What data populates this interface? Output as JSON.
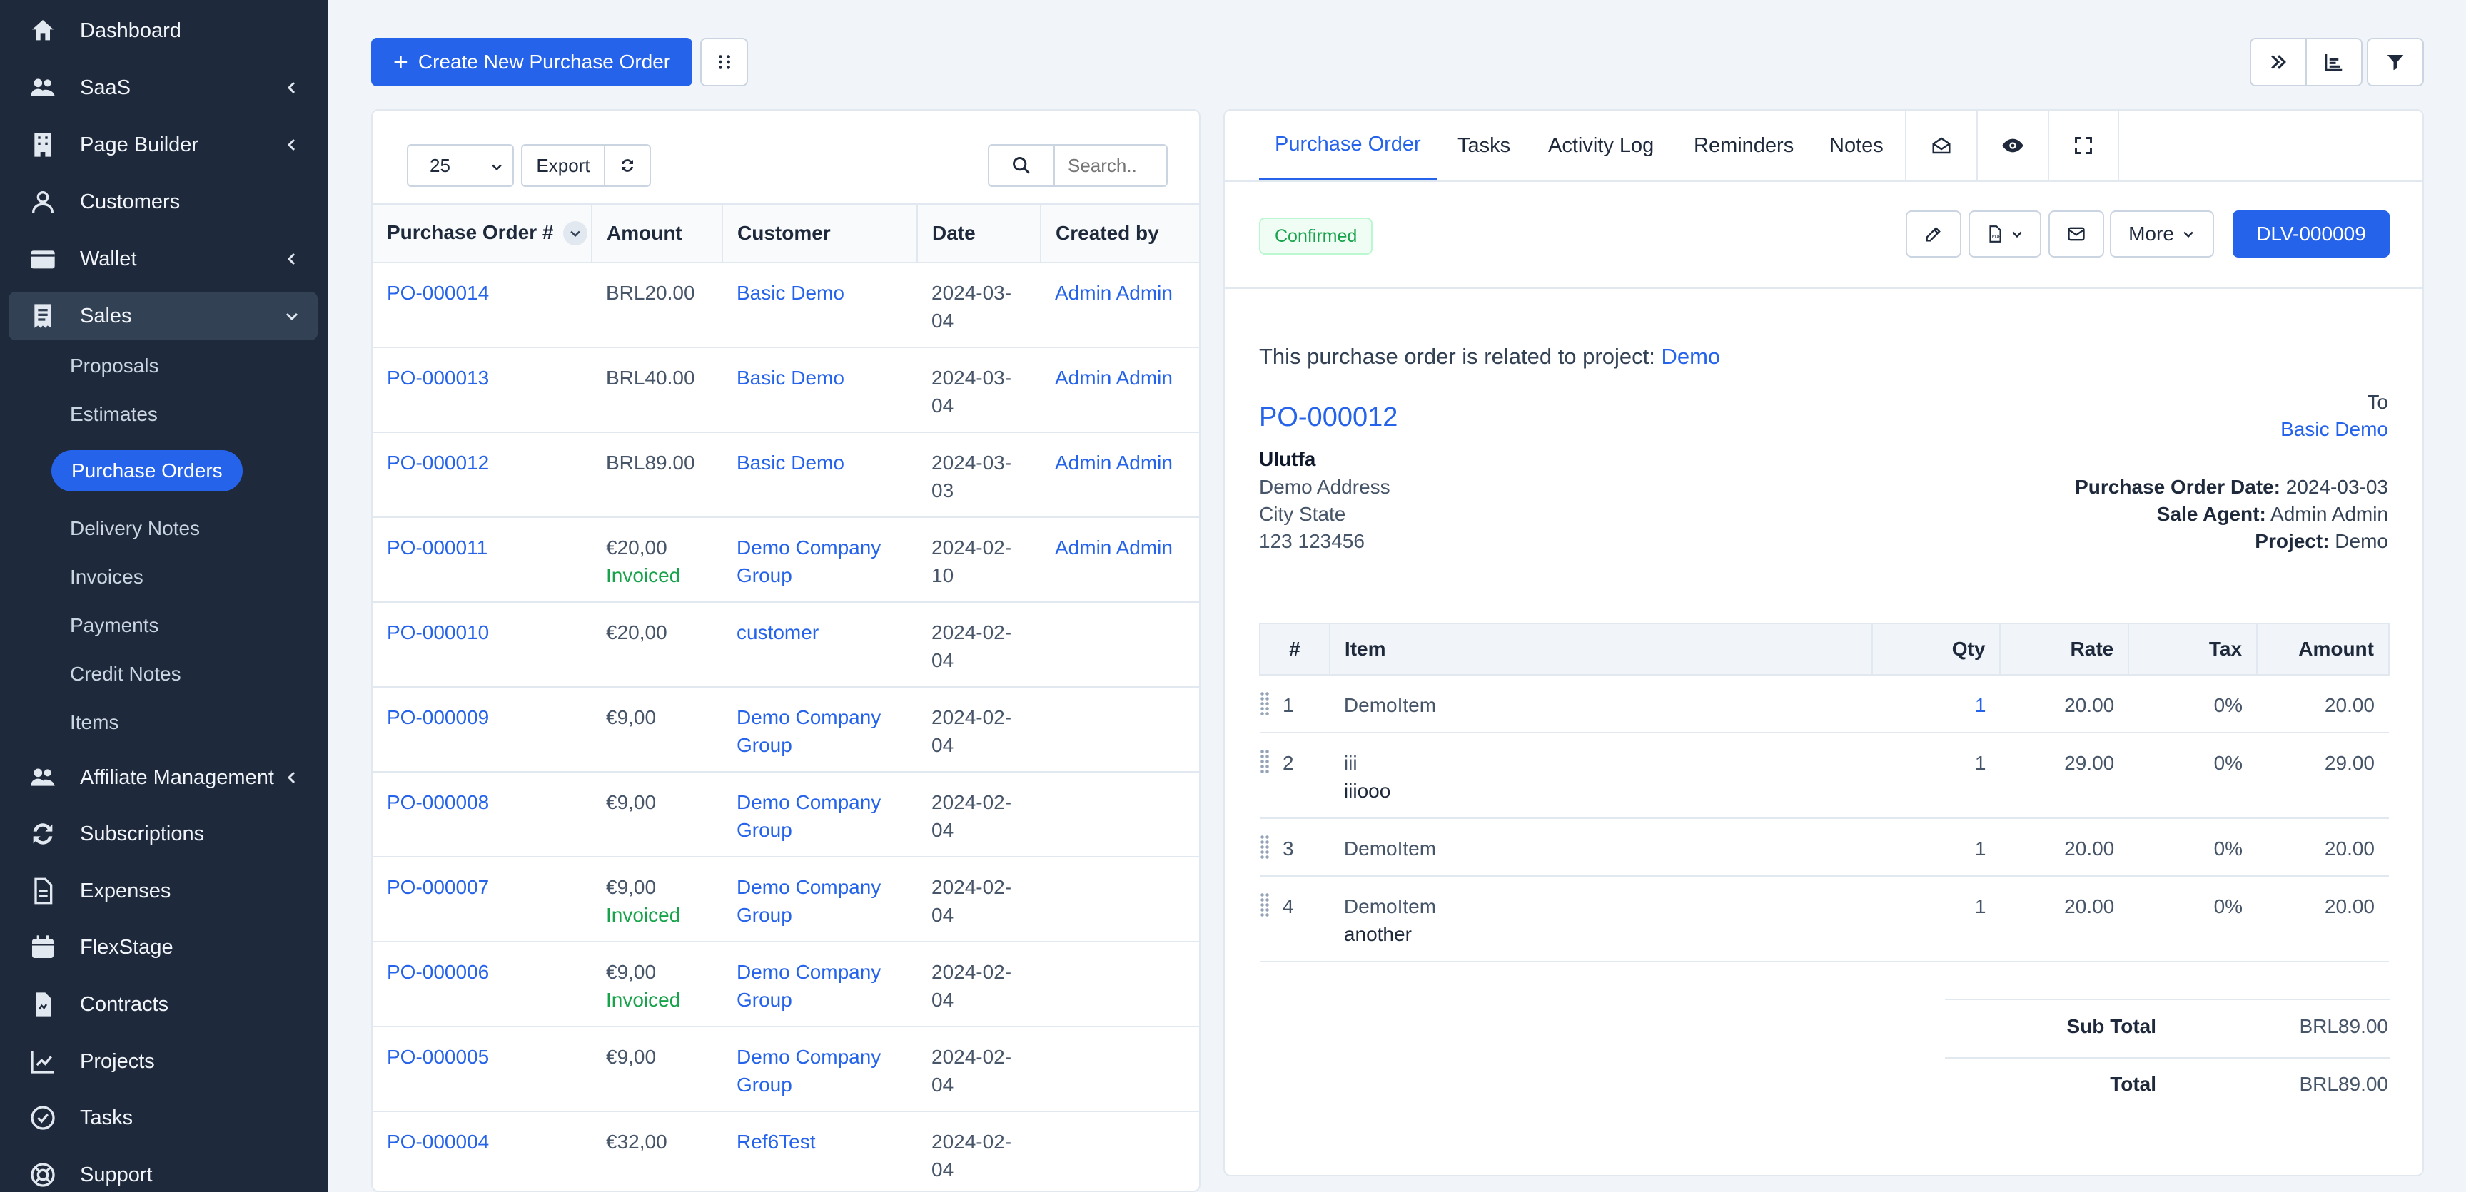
{
  "sidebar": {
    "items": [
      {
        "label": "Dashboard",
        "icon": "home-icon"
      },
      {
        "label": "SaaS",
        "icon": "users-icon"
      },
      {
        "label": "Page Builder",
        "icon": "building-icon"
      },
      {
        "label": "Customers",
        "icon": "user-icon"
      },
      {
        "label": "Wallet",
        "icon": "wallet-icon"
      },
      {
        "label": "Sales",
        "icon": "receipt-icon"
      },
      {
        "label": "Affiliate Management",
        "icon": "users-icon"
      },
      {
        "label": "Subscriptions",
        "icon": "refresh-icon"
      },
      {
        "label": "Expenses",
        "icon": "file-icon"
      },
      {
        "label": "FlexStage",
        "icon": "calendar-icon"
      },
      {
        "label": "Contracts",
        "icon": "contract-icon"
      },
      {
        "label": "Projects",
        "icon": "chart-icon"
      },
      {
        "label": "Tasks",
        "icon": "check-circle-icon"
      },
      {
        "label": "Support",
        "icon": "lifebuoy-icon"
      }
    ],
    "sales_sub": [
      "Proposals",
      "Estimates",
      "Purchase Orders",
      "Delivery Notes",
      "Invoices",
      "Payments",
      "Credit Notes",
      "Items"
    ]
  },
  "toolbar": {
    "create_label": "Create New Purchase Order"
  },
  "list": {
    "per_page": "25",
    "export_label": "Export",
    "search_placeholder": "Search..",
    "columns": [
      "Purchase Order #",
      "Amount",
      "Customer",
      "Date",
      "Created by"
    ],
    "rows": [
      {
        "po": "PO-000014",
        "amount": "BRL20.00",
        "status": "",
        "customer": "Basic Demo",
        "date": "2024-03-04",
        "created_by": "Admin Admin"
      },
      {
        "po": "PO-000013",
        "amount": "BRL40.00",
        "status": "",
        "customer": "Basic Demo",
        "date": "2024-03-04",
        "created_by": "Admin Admin"
      },
      {
        "po": "PO-000012",
        "amount": "BRL89.00",
        "status": "",
        "customer": "Basic Demo",
        "date": "2024-03-03",
        "created_by": "Admin Admin"
      },
      {
        "po": "PO-000011",
        "amount": "€20,00",
        "status": "Invoiced",
        "customer": "Demo Company Group",
        "date": "2024-02-10",
        "created_by": "Admin Admin"
      },
      {
        "po": "PO-000010",
        "amount": "€20,00",
        "status": "",
        "customer": "customer",
        "date": "2024-02-04",
        "created_by": ""
      },
      {
        "po": "PO-000009",
        "amount": "€9,00",
        "status": "",
        "customer": "Demo Company Group",
        "date": "2024-02-04",
        "created_by": ""
      },
      {
        "po": "PO-000008",
        "amount": "€9,00",
        "status": "",
        "customer": "Demo Company Group",
        "date": "2024-02-04",
        "created_by": ""
      },
      {
        "po": "PO-000007",
        "amount": "€9,00",
        "status": "Invoiced",
        "customer": "Demo Company Group",
        "date": "2024-02-04",
        "created_by": ""
      },
      {
        "po": "PO-000006",
        "amount": "€9,00",
        "status": "Invoiced",
        "customer": "Demo Company Group",
        "date": "2024-02-04",
        "created_by": ""
      },
      {
        "po": "PO-000005",
        "amount": "€9,00",
        "status": "",
        "customer": "Demo Company Group",
        "date": "2024-02-04",
        "created_by": ""
      },
      {
        "po": "PO-000004",
        "amount": "€32,00",
        "status": "",
        "customer": "Ref6Test",
        "date": "2024-02-04",
        "created_by": ""
      }
    ]
  },
  "detail": {
    "tabs": [
      "Purchase Order",
      "Tasks",
      "Activity Log",
      "Reminders",
      "Notes"
    ],
    "status": "Confirmed",
    "more_label": "More",
    "delivery_label": "DLV-000009",
    "related_text": "This purchase order is related to project: ",
    "related_project": "Demo",
    "po_number": "PO-000012",
    "from": {
      "company": "Ulutfa",
      "address": "Demo Address",
      "city": "City State",
      "zip": "123 123456"
    },
    "to_label": "To",
    "to_customer": "Basic Demo",
    "po_date_label": "Purchase Order Date:",
    "po_date": "2024-03-03",
    "agent_label": "Sale Agent:",
    "agent": "Admin Admin",
    "project_label": "Project:",
    "project": "Demo",
    "item_columns": [
      "#",
      "Item",
      "Qty",
      "Rate",
      "Tax",
      "Amount"
    ],
    "items": [
      {
        "n": "1",
        "name": "DemoItem",
        "desc": "",
        "qty": "1",
        "rate": "20.00",
        "tax": "0%",
        "amount": "20.00"
      },
      {
        "n": "2",
        "name": "iii",
        "desc": "iiiooo",
        "qty": "1",
        "rate": "29.00",
        "tax": "0%",
        "amount": "29.00"
      },
      {
        "n": "3",
        "name": "DemoItem",
        "desc": "",
        "qty": "1",
        "rate": "20.00",
        "tax": "0%",
        "amount": "20.00"
      },
      {
        "n": "4",
        "name": "DemoItem",
        "desc": "another",
        "qty": "1",
        "rate": "20.00",
        "tax": "0%",
        "amount": "20.00"
      }
    ],
    "subtotal_label": "Sub Total",
    "subtotal": "BRL89.00",
    "total_label": "Total",
    "total": "BRL89.00"
  },
  "colors": {
    "accent": "#2563eb",
    "sidebar": "#1e293b",
    "success": "#16a34a"
  }
}
